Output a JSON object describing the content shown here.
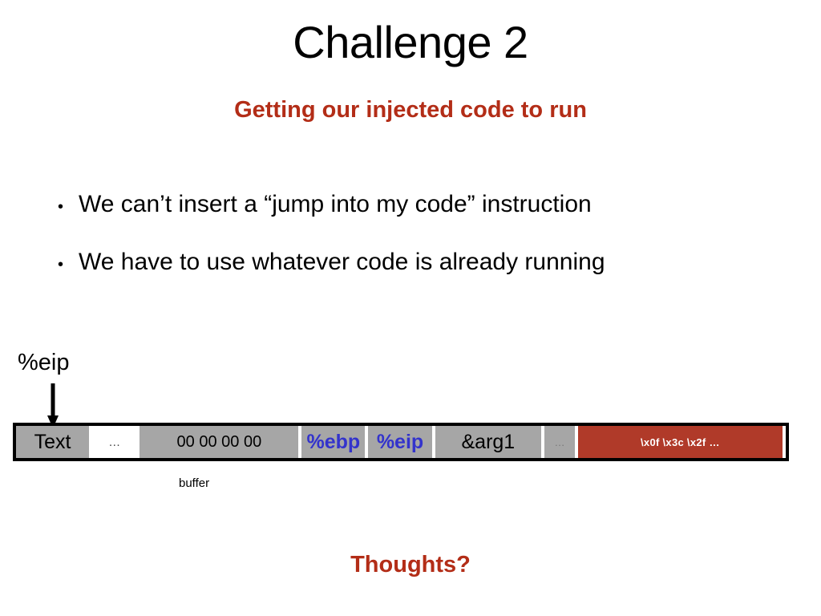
{
  "slide": {
    "title": "Challenge 2",
    "subtitle": "Getting our injected code to run",
    "bullets": [
      {
        "marker": "•",
        "text": "We can’t insert a “jump into my code” instruction"
      },
      {
        "marker": "•",
        "text": "We have to use whatever code is already running"
      }
    ],
    "pointer": {
      "label": "%eip",
      "icon": "down-arrow-icon"
    },
    "memory_diagram": {
      "caption": "buffer",
      "cells": [
        {
          "label": "Text",
          "kind": "gray",
          "name": "memory-cell-text"
        },
        {
          "label": "…",
          "kind": "blank",
          "name": "memory-cell-gap-left"
        },
        {
          "label": "00 00 00 00",
          "kind": "gray",
          "name": "memory-cell-zeros"
        },
        {
          "label": "%ebp",
          "kind": "gray",
          "name": "memory-cell-ebp"
        },
        {
          "label": "%eip",
          "kind": "gray",
          "name": "memory-cell-eip"
        },
        {
          "label": "&arg1",
          "kind": "gray",
          "name": "memory-cell-arg1"
        },
        {
          "label": "…",
          "kind": "gray",
          "name": "memory-cell-gap-right"
        },
        {
          "label": "\\x0f \\x3c \\x2f …",
          "kind": "shellcode",
          "name": "memory-cell-shellcode"
        }
      ]
    },
    "footer_question": "Thoughts?",
    "colors": {
      "accent_red": "#b32d17",
      "shellcode_red": "#b03a29",
      "register_blue": "#3333cc",
      "cell_gray": "#a6a6a6",
      "text_black": "#000000",
      "background": "#ffffff"
    }
  }
}
